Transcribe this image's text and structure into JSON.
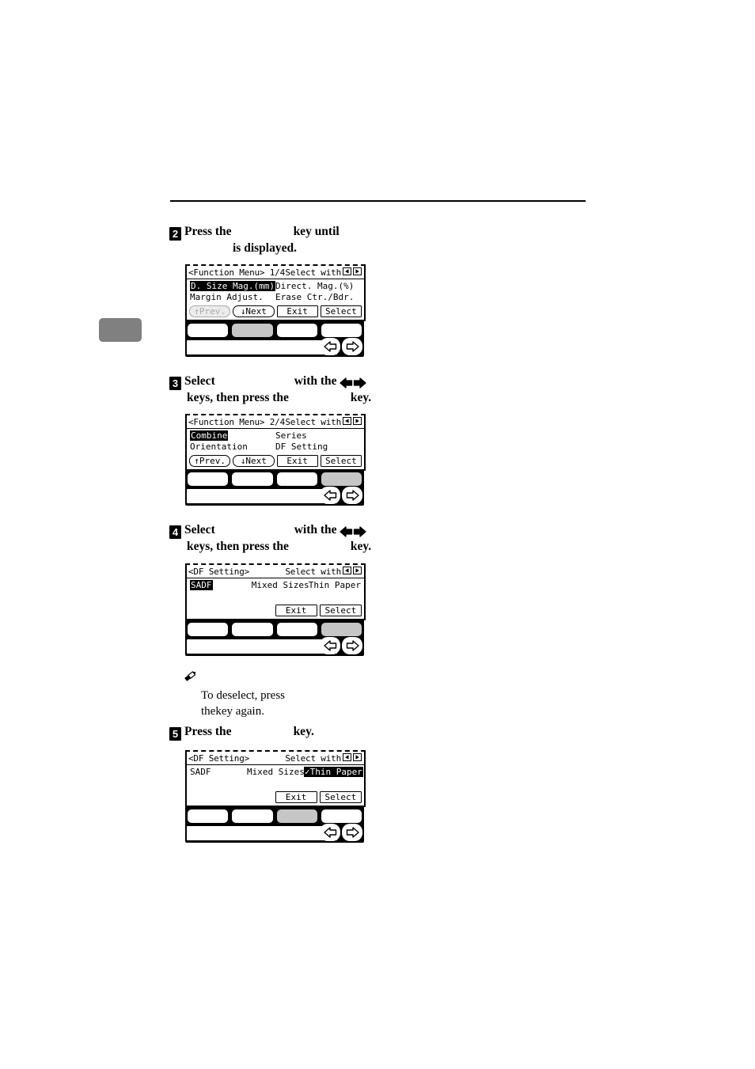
{
  "page": {
    "margin_tab": "",
    "rule": ""
  },
  "steps": [
    {
      "num": "2",
      "line1_a": "Press the",
      "line1_b": "key until",
      "line2": "is displayed.",
      "lcd": {
        "title_left": "<Function Menu> 1/4",
        "title_right": "Select with",
        "rows": [
          [
            "D. Size Mag.(mm)",
            "Direct. Mag.(%)"
          ],
          [
            "Margin Adjust.",
            "Erase Ctr./Bdr."
          ]
        ],
        "highlight": "D. Size Mag.(mm)",
        "softkeys": [
          "↑Prev.",
          "↓Next",
          "Exit",
          "Select"
        ],
        "softkey_disabled": "↑Prev."
      },
      "keys_active_index": 1
    },
    {
      "num": "3",
      "line1_a": "Select",
      "line1_b": "with the",
      "line2_a": "keys, then press the",
      "line2_b": "key.",
      "lcd": {
        "title_left": "<Function Menu> 2/4",
        "title_right": "Select with",
        "rows": [
          [
            "Combine",
            "Series"
          ],
          [
            "Orientation",
            "DF Setting"
          ]
        ],
        "highlight": "Combine",
        "softkeys": [
          "↑Prev.",
          "↓Next",
          "Exit",
          "Select"
        ],
        "softkey_disabled": ""
      },
      "keys_active_index": 3
    },
    {
      "num": "4",
      "line1_a": "Select",
      "line1_b": "with the",
      "line2_a": "keys, then press the",
      "line2_b": "key.",
      "lcd": {
        "title_left": "<DF Setting>",
        "title_right": "Select with",
        "rows3": [
          "SADF",
          "Mixed Sizes",
          "Thin Paper"
        ],
        "highlight": "SADF",
        "softkeys": [
          "",
          "",
          "Exit",
          "Select"
        ],
        "softkey_disabled": ""
      },
      "keys_active_index": 3
    },
    {
      "num": "5",
      "line1_a": "Press the",
      "line1_b": "key.",
      "lcd": {
        "title_left": "<DF Setting>",
        "title_right": "Select with",
        "rows3": [
          "SADF",
          "Mixed Sizes",
          "✓Thin Paper"
        ],
        "highlight": "✓Thin Paper",
        "softkeys": [
          "",
          "",
          "Exit",
          "Select"
        ],
        "softkey_disabled": ""
      },
      "keys_active_index": 2
    }
  ],
  "note": {
    "line1_a": "To  deselect",
    "line1_b": ",  press",
    "line2_a": "the",
    "line2_b": "key again."
  }
}
